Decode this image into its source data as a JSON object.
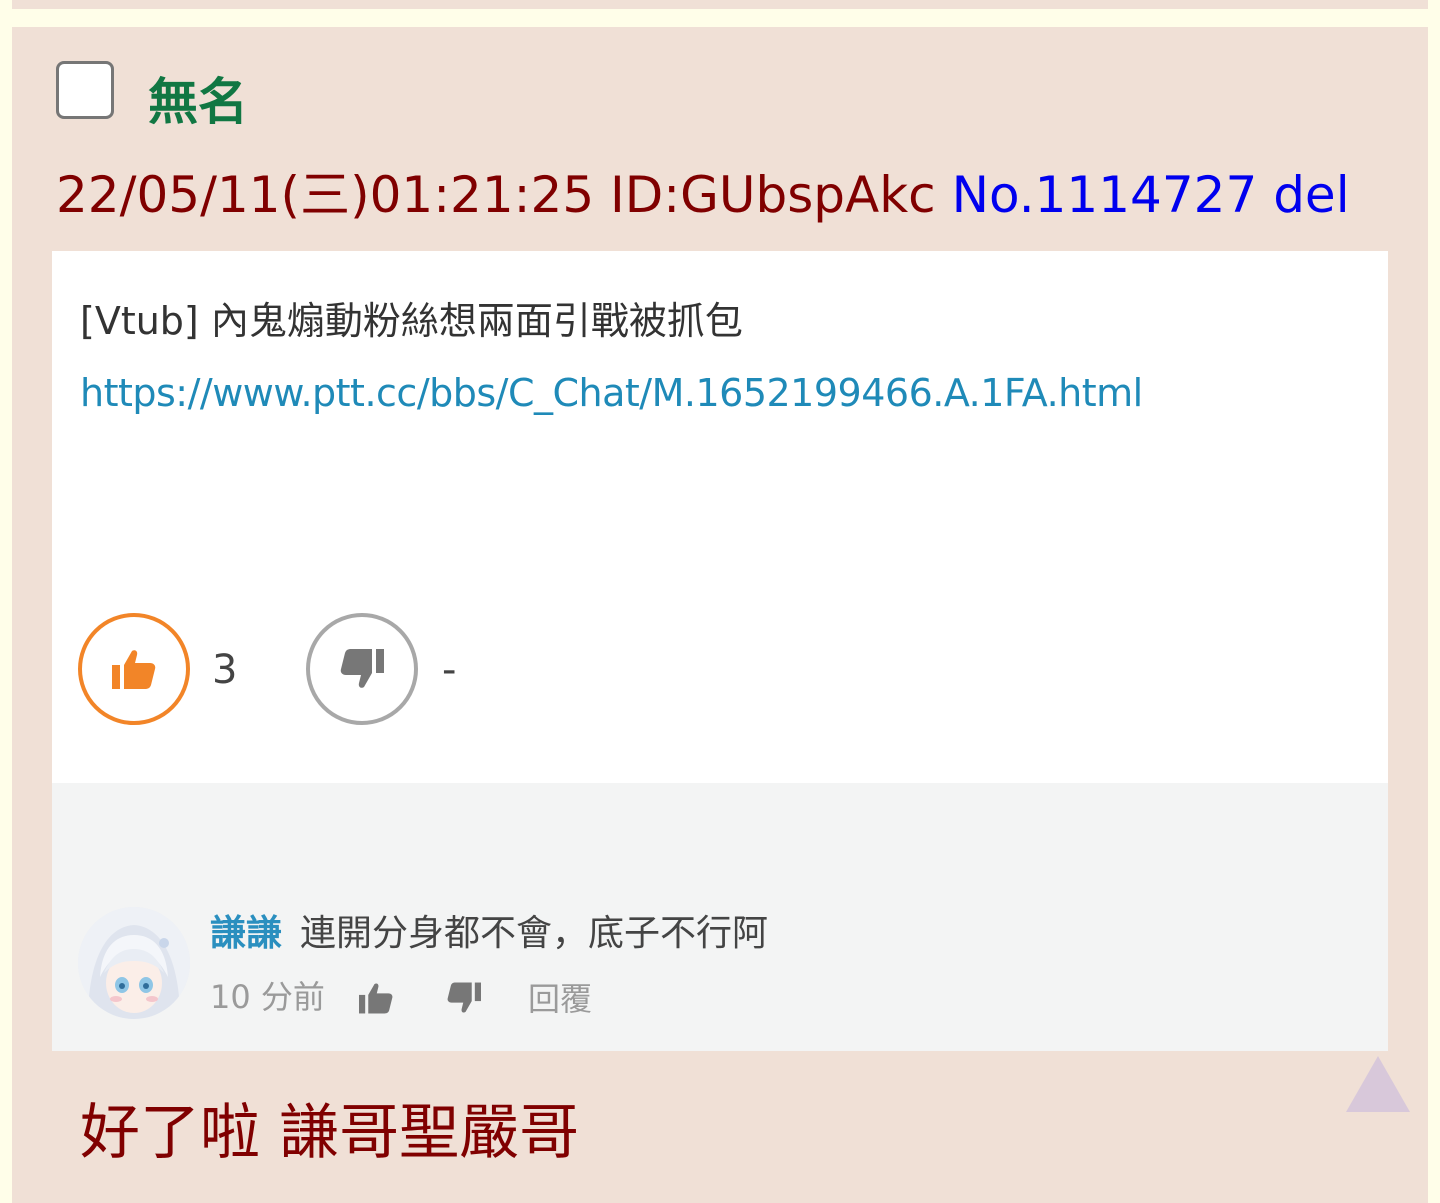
{
  "post": {
    "name": "無名",
    "date": "22/05/11(三)01:21:25",
    "id": "ID:GUbspAkc",
    "number": "No.1114727",
    "del_label": "del",
    "reply": "好了啦 謙哥聖嚴哥"
  },
  "embed": {
    "title": "[Vtub] 內鬼煽動粉絲想兩面引戰被抓包",
    "link": "https://www.ptt.cc/bbs/C_Chat/M.1652199466.A.1FA.html",
    "likes": "3",
    "dislikes": "-",
    "like_color": "#f28528",
    "dislike_color": "#a8a8a8"
  },
  "comment": {
    "author": "謙謙",
    "text": "連開分身都不會，底子不行阿",
    "time": "10 分前",
    "reply_label": "回覆"
  },
  "icons": {
    "like": "thumbs-up-icon",
    "dislike": "thumbs-down-icon",
    "scroll": "scroll-to-top-icon"
  }
}
